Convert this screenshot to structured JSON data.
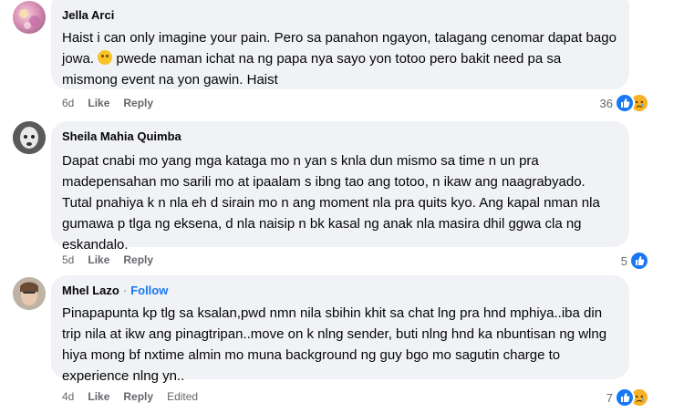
{
  "comments": [
    {
      "author": "Jella Arci",
      "follow": "",
      "text_before_emoji": "Haist i can only imagine your pain. Pero sa panahon ngayon, talagang cenomar dapat bago jowa.",
      "text_after_emoji": "pwede naman ichat na ng papa nya sayo yon totoo pero bakit need pa sa mismong event na yon gawin. Haist",
      "emoji": "worried-face-emoji",
      "time": "6d",
      "like_label": "Like",
      "reply_label": "Reply",
      "edited": "",
      "reaction_count": "36",
      "reactions": [
        "like-icon",
        "sad-icon"
      ]
    },
    {
      "author": "Sheila Mahia Quimba",
      "follow": "",
      "text": "Dapat cnabi mo yang mga kataga mo n yan s knla dun mismo sa time n un pra madepensahan mo sarili mo at ipaalam s ibng tao ang totoo, n ikaw ang naagrabyado. Tutal pnahiya k n nla eh d sirain mo n ang moment nla pra quits kyo. Ang kapal nman nla gumawa p tlga ng eksena, d nla naisip n bk kasal ng anak nla masira dhil ggwa cla ng eskandalo.",
      "time": "5d",
      "like_label": "Like",
      "reply_label": "Reply",
      "edited": "",
      "reaction_count": "5",
      "reactions": [
        "like-icon"
      ]
    },
    {
      "author": "Mhel Lazo",
      "separator": "·",
      "follow": "Follow",
      "text": "Pinapapunta kp tlg sa ksalan,pwd nmn nila sbihin khit sa chat lng pra hnd mphiya..iba din trip nila at ikw ang pinagtripan..move on k nlng sender, buti nlng hnd ka nbuntisan ng wlng hiya mong bf nxtime almin mo muna background ng guy bgo mo sagutin charge to experience nlng yn..",
      "time": "4d",
      "like_label": "Like",
      "reply_label": "Reply",
      "edited": "Edited",
      "reaction_count": "7",
      "reactions": [
        "like-icon",
        "sad-icon"
      ]
    }
  ],
  "colors": {
    "bubble": "#f0f2f5",
    "meta": "#65676b",
    "link": "#1877f2",
    "like": "#1877f2",
    "sad": "#f7b125"
  }
}
